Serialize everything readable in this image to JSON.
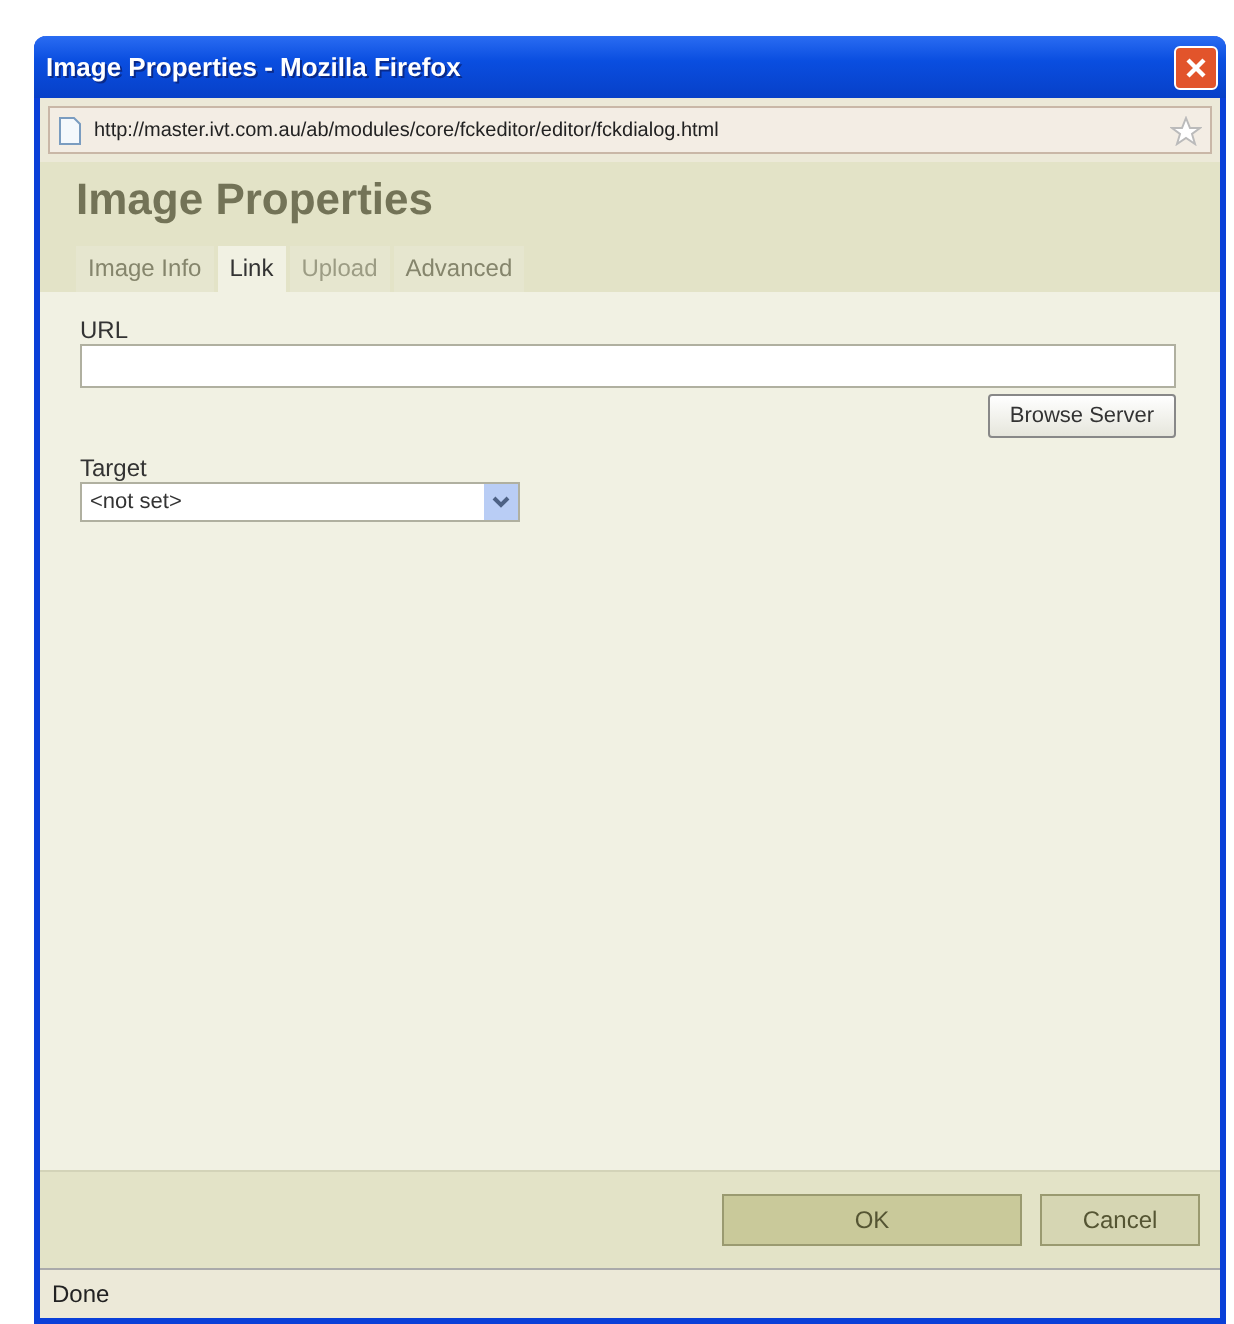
{
  "window": {
    "title": "Image Properties - Mozilla Firefox"
  },
  "address_bar": {
    "url": "http://master.ivt.com.au/ab/modules/core/fckeditor/editor/fckdialog.html"
  },
  "dialog": {
    "title": "Image Properties"
  },
  "tabs": [
    {
      "label": "Image Info",
      "selected": false,
      "disabled": false
    },
    {
      "label": "Link",
      "selected": true,
      "disabled": false
    },
    {
      "label": "Upload",
      "selected": false,
      "disabled": true
    },
    {
      "label": "Advanced",
      "selected": false,
      "disabled": false
    }
  ],
  "url_field": {
    "label": "URL"
  },
  "browse_button": {
    "label": "Browse Server"
  },
  "target": {
    "label": "Target",
    "value": "<not set>"
  },
  "buttons": [
    {
      "label": "OK",
      "primary": true
    },
    {
      "label": "Cancel",
      "primary": false
    }
  ],
  "status_bar": {
    "text": "Done"
  }
}
